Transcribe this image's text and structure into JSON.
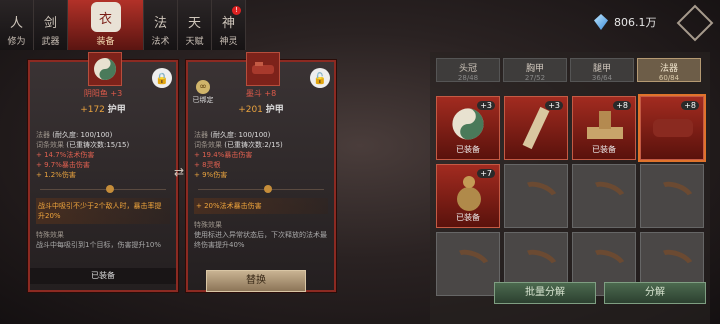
{
  "nav": [
    {
      "label": "修为",
      "icon": "人"
    },
    {
      "label": "武器",
      "icon": "剑"
    },
    {
      "label": "装备",
      "icon": "衣"
    },
    {
      "label": "法术",
      "icon": "法"
    },
    {
      "label": "天赋",
      "icon": "天"
    },
    {
      "label": "神灵",
      "icon": "神",
      "badge": "!"
    }
  ],
  "currency": {
    "value": "806.1万"
  },
  "left": {
    "name": "阴阳鱼 +3",
    "mainstat_val": "+172",
    "mainstat_lbl": "护甲",
    "lines": [
      {
        "a": "法器",
        "b": "(耐久度: 100/100)"
      },
      {
        "a": "词条效果",
        "b": "(已重铸次数:15/15)"
      }
    ],
    "red": [
      "+ 14.7%法术伤害",
      "+ 9.7%暴击伤害"
    ],
    "gold": "+ 1.2%伤害",
    "special": "战斗中吸引不少于2个敌人时，暴击率提升20%",
    "title": "特殊效果",
    "desc": "战斗中每吸引到1个目标，伤害提升10%",
    "foot": "已装备"
  },
  "right": {
    "name": "墨斗 +8",
    "chain": "已绑定",
    "mainstat_val": "+201",
    "mainstat_lbl": "护甲",
    "lines": [
      {
        "a": "法器",
        "b": "(耐久度: 100/100)"
      },
      {
        "a": "词条效果",
        "b": "(已重铸次数:2/15)"
      }
    ],
    "red": [
      "+ 19.4%暴击伤害",
      "+ 8灵根"
    ],
    "gold": "+ 9%伤害",
    "special": "+ 20%法术暴击伤害",
    "title": "特殊效果",
    "desc": "使用标进入异常状态后，下次释放的法术最终伤害提升40%",
    "replace": "替换"
  },
  "tabs": [
    {
      "label": "头冠",
      "count": "28/48"
    },
    {
      "label": "胸甲",
      "count": "27/52"
    },
    {
      "label": "腿甲",
      "count": "36/64"
    },
    {
      "label": "法器",
      "count": "60/84"
    }
  ],
  "slots": [
    {
      "plus": "+3",
      "eq": "已装备",
      "type": "yinyang"
    },
    {
      "plus": "+3",
      "eq": "",
      "type": "scroll"
    },
    {
      "plus": "+8",
      "eq": "已装备",
      "type": "stamp"
    },
    {
      "plus": "+8",
      "eq": "",
      "type": "dragon"
    },
    {
      "plus": "+7",
      "eq": "已装备",
      "type": "gourd"
    },
    {
      "plus": "",
      "eq": "",
      "type": "horn"
    },
    {
      "plus": "",
      "eq": "",
      "type": "horn"
    },
    {
      "plus": "",
      "eq": "",
      "type": "horn"
    },
    {
      "plus": "",
      "eq": "",
      "type": "horn"
    },
    {
      "plus": "",
      "eq": "",
      "type": "horn"
    },
    {
      "plus": "",
      "eq": "",
      "type": "horn"
    },
    {
      "plus": "",
      "eq": "",
      "type": "horn"
    }
  ],
  "buttons": {
    "bulk": "批量分解",
    "decompose": "分解"
  }
}
